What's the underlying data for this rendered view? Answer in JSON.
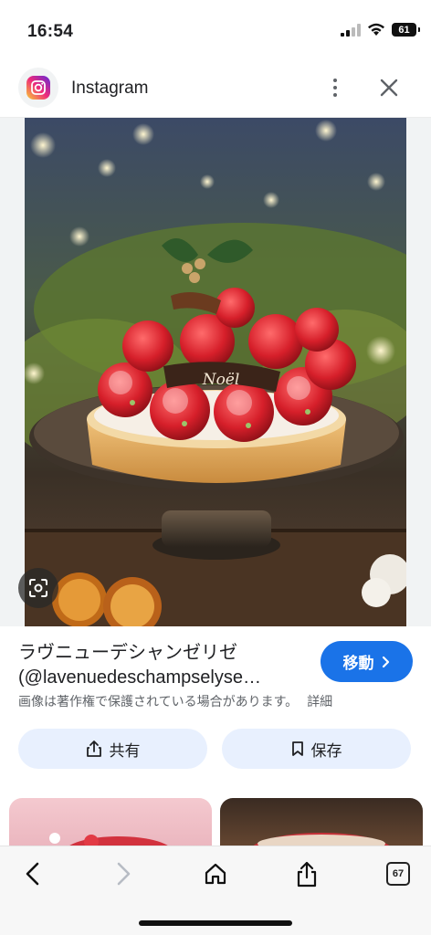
{
  "status_bar": {
    "time": "16:54",
    "battery": "61"
  },
  "header": {
    "app_name": "Instagram",
    "icon": "instagram-icon"
  },
  "image": {
    "description_icon": "lens-search-icon",
    "text_on_cake": "Noël"
  },
  "info": {
    "title_line1": "ラヴニューデシャンゼリゼ",
    "title_line2": "(@lavenuedeschampselyse…",
    "visit_label": "移動",
    "copyright": "画像は著作権で保護されている場合があります。",
    "details_label": "詳細"
  },
  "actions": {
    "share_label": "共有",
    "save_label": "保存"
  },
  "toolbar": {
    "tab_count": "67"
  },
  "colors": {
    "accent": "#1a73e8",
    "chip_bg": "#e8f0fe"
  }
}
